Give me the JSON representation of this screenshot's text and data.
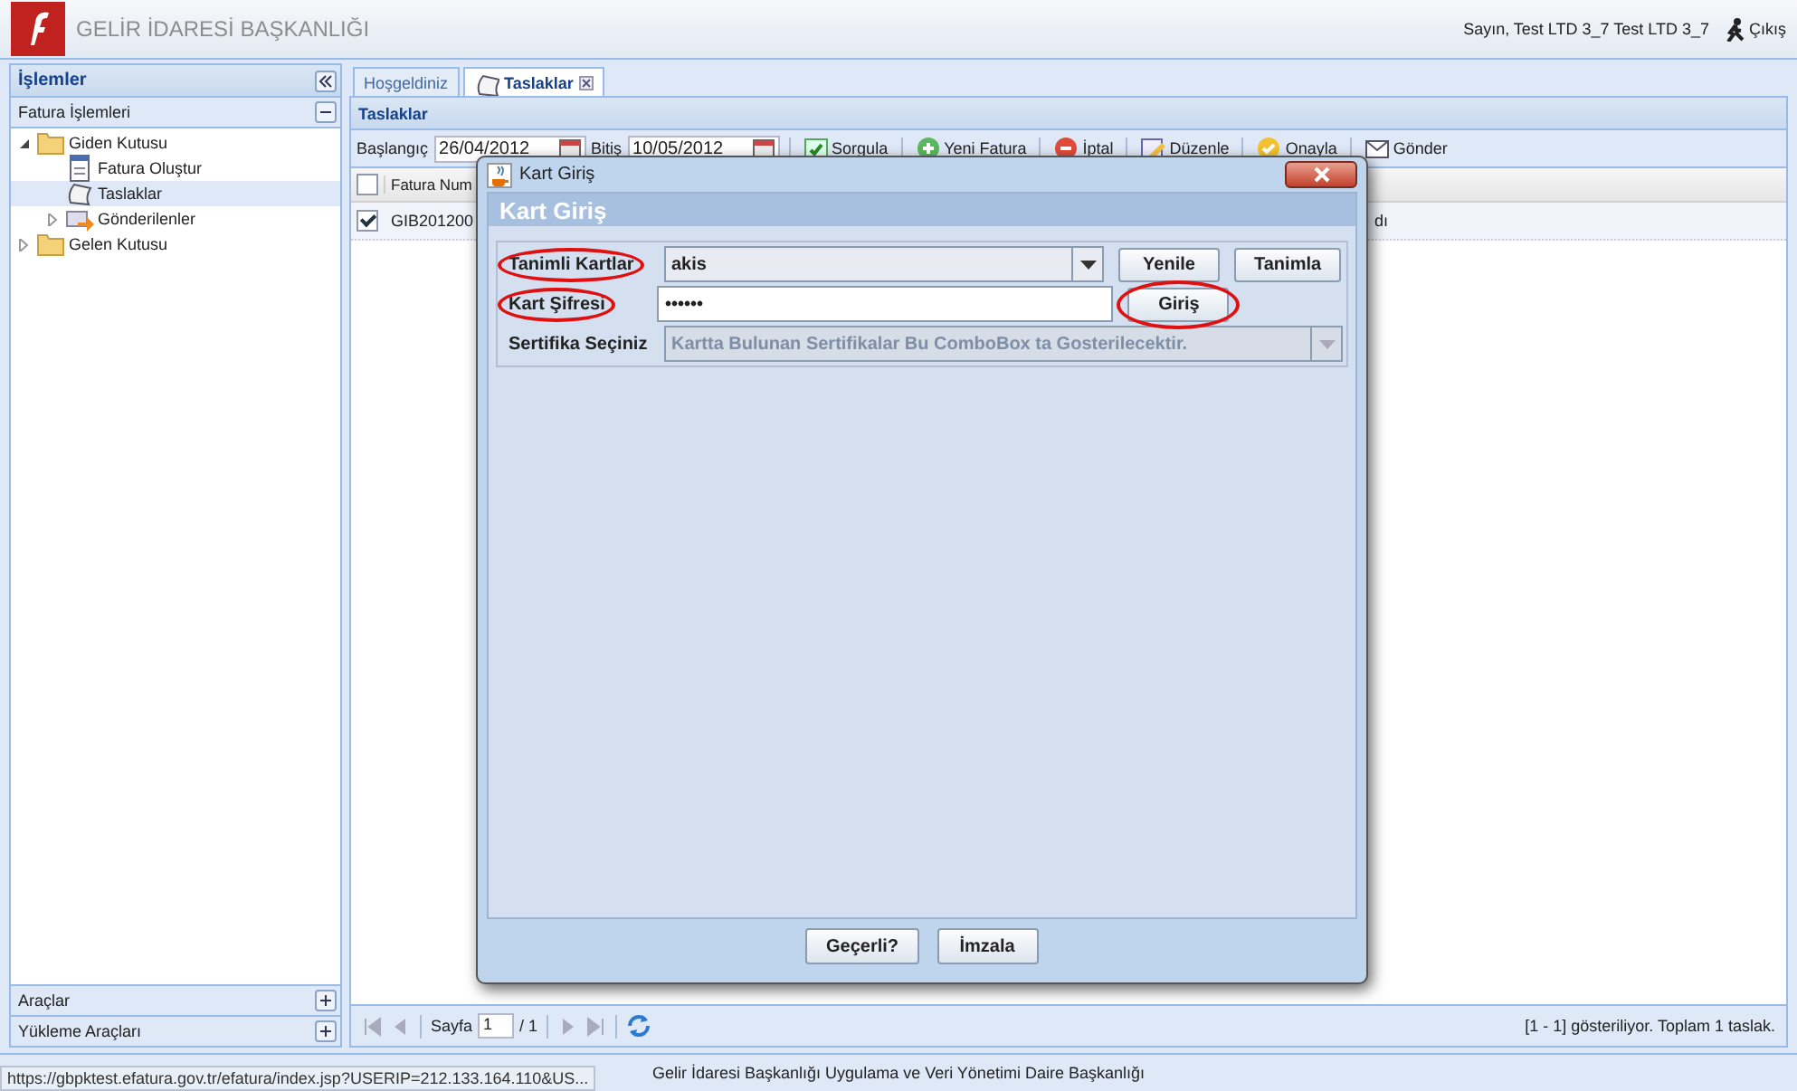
{
  "header": {
    "title": "GELİR İDARESİ BAŞKANLIĞI",
    "user": "Sayın, Test LTD 3_7 Test LTD 3_7",
    "logout": "Çıkış"
  },
  "sidebar": {
    "title": "İşlemler",
    "sections": [
      {
        "title": "Fatura İşlemleri",
        "expanded": true,
        "tree": [
          {
            "label": "Giden Kutusu",
            "kind": "folder",
            "expanded": true,
            "selected": false,
            "children": [
              {
                "label": "Fatura Oluştur",
                "kind": "document",
                "selected": false
              },
              {
                "label": "Taslaklar",
                "kind": "drafts",
                "selected": true
              },
              {
                "label": "Gönderilenler",
                "kind": "sent",
                "expanded": false,
                "selected": false
              }
            ]
          },
          {
            "label": "Gelen Kutusu",
            "kind": "folder",
            "expanded": false,
            "selected": false
          }
        ]
      },
      {
        "title": "Araçlar",
        "expanded": false
      },
      {
        "title": "Yükleme Araçları",
        "expanded": false
      }
    ]
  },
  "tabs": [
    {
      "label": "Hoşgeldiniz",
      "selected": false,
      "closable": false
    },
    {
      "label": "Taslaklar",
      "selected": true,
      "closable": true
    }
  ],
  "panel": {
    "title": "Taslaklar",
    "toolbar": {
      "start_label": "Başlangıç",
      "start": "26/04/2012",
      "end_label": "Bitiş",
      "end": "10/05/2012",
      "actions": [
        {
          "label": "Sorgula",
          "kind": "query"
        },
        {
          "label": "Yeni Fatura",
          "kind": "new"
        },
        {
          "label": "İptal",
          "kind": "cancel"
        },
        {
          "label": "Düzenle",
          "kind": "edit"
        },
        {
          "label": "Onayla",
          "kind": "approve"
        },
        {
          "label": "Gönder",
          "kind": "send"
        }
      ]
    },
    "grid": {
      "header_checked": false,
      "columns": [
        "Fatura Num"
      ],
      "rows": [
        {
          "checked": true,
          "cells": [
            "GIB201200",
            "dı"
          ]
        }
      ]
    },
    "pager": {
      "page_label": "Sayfa",
      "page": "1",
      "of": "/ 1",
      "summary": "[1 - 1] gösteriliyor. Toplam 1 taslak."
    }
  },
  "dialog": {
    "title": "Kart Giriş",
    "heading": "Kart Giriş",
    "rows": [
      {
        "kind": "combo",
        "label": "Tanimli Kartlar",
        "value": "akis",
        "circled": true,
        "buttons": [
          {
            "label": "Yenile",
            "circled": false
          },
          {
            "label": "Tanimla",
            "circled": false
          }
        ]
      },
      {
        "kind": "password",
        "label": "Kart Şifresi",
        "value": "••••••",
        "circled": true,
        "buttons": [
          {
            "label": "Giriş",
            "circled": true
          }
        ]
      },
      {
        "kind": "combo",
        "label": "Sertifika Seçiniz",
        "value": "Kartta Bulunan Sertifikalar Bu ComboBox ta Gosterilecektir.",
        "disabled": true,
        "circled": false,
        "buttons": []
      }
    ],
    "footer_buttons": [
      "Geçerli?",
      "İmzala"
    ]
  },
  "footer": "Gelir İdaresi Başkanlığı Uygulama ve Veri Yönetimi Daire Başkanlığı",
  "status_url": "https://gbpktest.efatura.gov.tr/efatura/index.jsp?USERIP=212.133.164.110&US..."
}
